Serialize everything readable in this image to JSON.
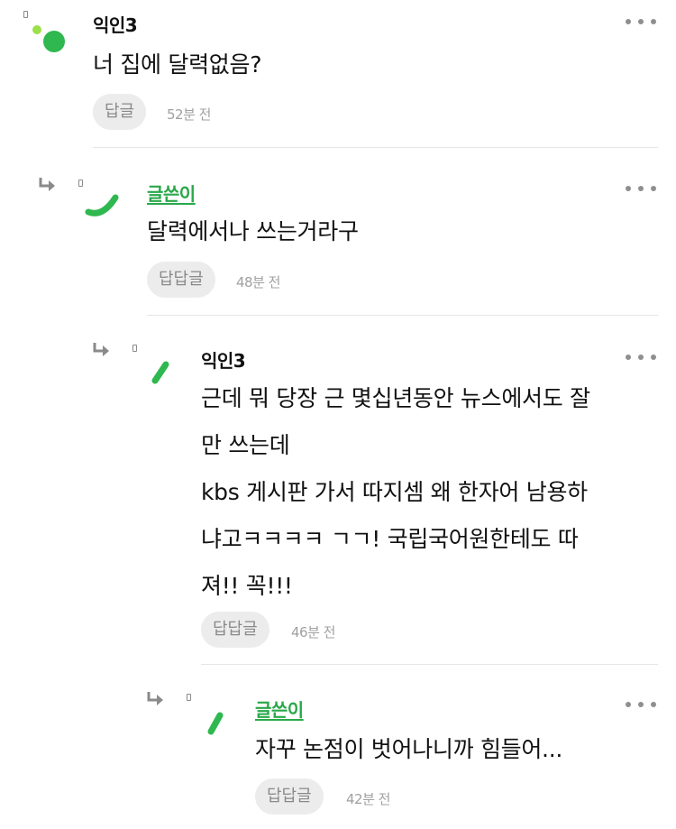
{
  "icons": {
    "more": "more-dots-icon",
    "reply": "reply-arrow-icon"
  },
  "colors": {
    "op": "#2aa84a",
    "avatar": "#2fb84f",
    "avatar_light": "#9be04a"
  },
  "comments": [
    {
      "author": "익인3",
      "lines": [
        "너 집에 달력없음?"
      ],
      "reply_label": "답글",
      "time": "52분 전"
    },
    {
      "author": "글쓴이",
      "lines": [
        "달력에서나 쓰는거라구"
      ],
      "reply_label": "답답글",
      "time": "48분 전"
    },
    {
      "author": "익인3",
      "lines": [
        "근데 뭐 당장 근 몇십년동안 뉴스에서도 잘",
        "만 쓰는데",
        "kbs 게시판 가서 따지셈 왜 한자어 남용하",
        "냐고ㅋㅋㅋㅋ ㄱㄱ! 국립국어원한테도 따",
        "져!! 꼭!!!"
      ],
      "reply_label": "답답글",
      "time": "46분 전"
    },
    {
      "author": "글쓴이",
      "lines": [
        "자꾸 논점이 벗어나니까 힘들어..."
      ],
      "reply_label": "답답글",
      "time": "42분 전"
    }
  ]
}
